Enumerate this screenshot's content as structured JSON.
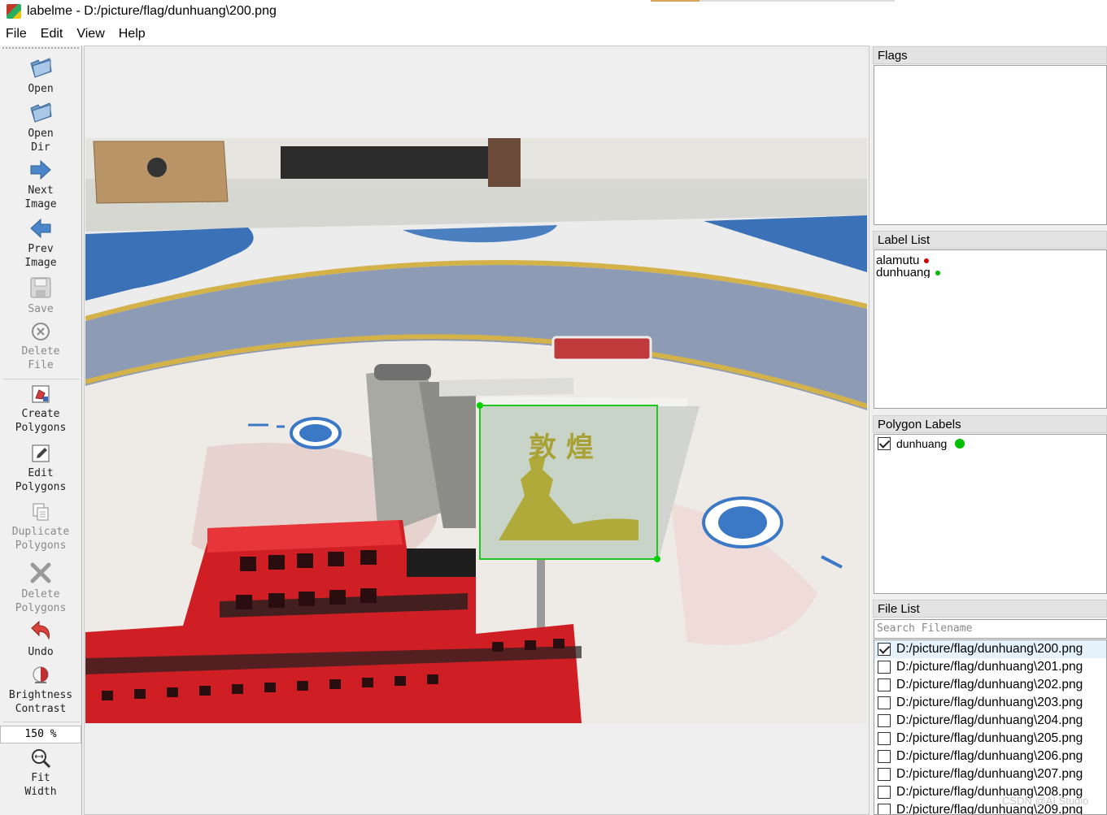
{
  "window": {
    "title": "labelme - D:/picture/flag/dunhuang\\200.png"
  },
  "menu": [
    "File",
    "Edit",
    "View",
    "Help"
  ],
  "toolbar": {
    "open": "Open",
    "open_dir": [
      "Open",
      "Dir"
    ],
    "next_image": [
      "Next",
      "Image"
    ],
    "prev_image": [
      "Prev",
      "Image"
    ],
    "save": "Save",
    "delete_file": [
      "Delete",
      "File"
    ],
    "create_polygons": [
      "Create",
      "Polygons"
    ],
    "edit_polygons": [
      "Edit",
      "Polygons"
    ],
    "duplicate_polygons": [
      "Duplicate",
      "Polygons"
    ],
    "delete_polygons": [
      "Delete",
      "Polygons"
    ],
    "undo": "Undo",
    "brightness_contrast": [
      "Brightness",
      "Contrast"
    ],
    "zoom": "150 %",
    "fit_width": [
      "Fit",
      "Width"
    ]
  },
  "panels": {
    "flags_title": "Flags",
    "label_list_title": "Label List",
    "polygon_labels_title": "Polygon Labels",
    "file_list_title": "File List"
  },
  "label_list": [
    {
      "name": "alamutu",
      "color": "#d00000"
    },
    {
      "name": "dunhuang",
      "color": "#00c000"
    }
  ],
  "polygon_labels": [
    {
      "name": "dunhuang",
      "checked": true,
      "color": "#00c000"
    }
  ],
  "image": {
    "sign_text": "敦 煌"
  },
  "file_search": {
    "placeholder": "Search Filename"
  },
  "files": [
    {
      "path": "D:/picture/flag/dunhuang\\200.png",
      "checked": true
    },
    {
      "path": "D:/picture/flag/dunhuang\\201.png",
      "checked": false
    },
    {
      "path": "D:/picture/flag/dunhuang\\202.png",
      "checked": false
    },
    {
      "path": "D:/picture/flag/dunhuang\\203.png",
      "checked": false
    },
    {
      "path": "D:/picture/flag/dunhuang\\204.png",
      "checked": false
    },
    {
      "path": "D:/picture/flag/dunhuang\\205.png",
      "checked": false
    },
    {
      "path": "D:/picture/flag/dunhuang\\206.png",
      "checked": false
    },
    {
      "path": "D:/picture/flag/dunhuang\\207.png",
      "checked": false
    },
    {
      "path": "D:/picture/flag/dunhuang\\208.png",
      "checked": false
    },
    {
      "path": "D:/picture/flag/dunhuang\\209.png",
      "checked": false
    }
  ],
  "watermark": "CSDN @AI Studio"
}
